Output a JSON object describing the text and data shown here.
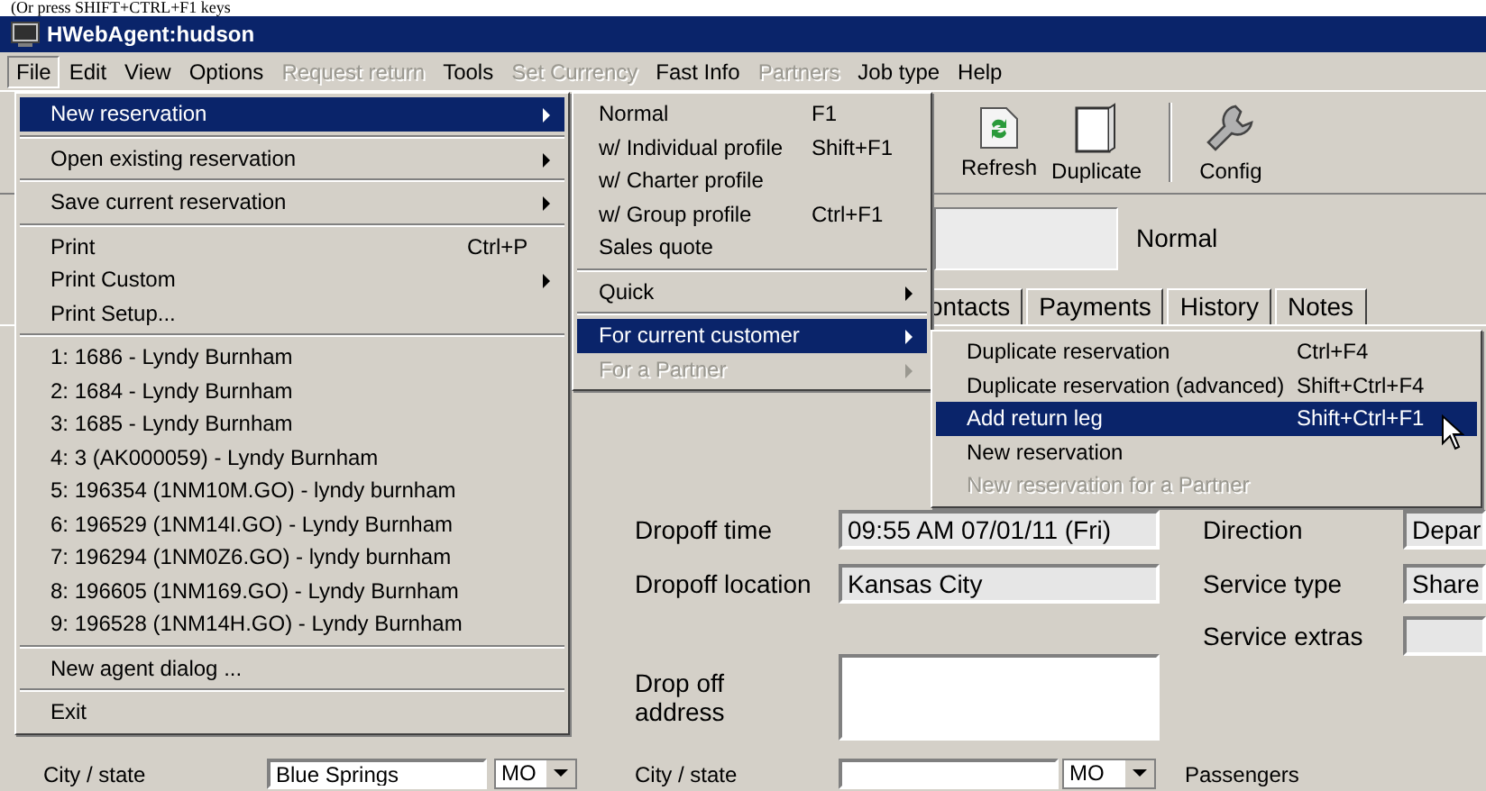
{
  "caption": "(Or press SHIFT+CTRL+F1 keys",
  "window": {
    "title": "HWebAgent:hudson"
  },
  "menubar": [
    {
      "label": "File",
      "selected": true,
      "disabled": false
    },
    {
      "label": "Edit",
      "selected": false,
      "disabled": false
    },
    {
      "label": "View",
      "selected": false,
      "disabled": false
    },
    {
      "label": "Options",
      "selected": false,
      "disabled": false
    },
    {
      "label": "Request return",
      "selected": false,
      "disabled": true
    },
    {
      "label": "Tools",
      "selected": false,
      "disabled": false
    },
    {
      "label": "Set Currency",
      "selected": false,
      "disabled": true
    },
    {
      "label": "Fast Info",
      "selected": false,
      "disabled": false
    },
    {
      "label": "Partners",
      "selected": false,
      "disabled": true
    },
    {
      "label": "Job type",
      "selected": false,
      "disabled": false
    },
    {
      "label": "Help",
      "selected": false,
      "disabled": false
    }
  ],
  "toolbar": [
    {
      "label": "Refresh",
      "kind": "refresh"
    },
    {
      "label": "Duplicate",
      "kind": "page"
    },
    {
      "label": "Config",
      "kind": "wrench"
    }
  ],
  "job_type": "Normal",
  "tabs": [
    {
      "label": "ontacts"
    },
    {
      "label": "Payments"
    },
    {
      "label": "History"
    },
    {
      "label": "Notes"
    }
  ],
  "form": [
    {
      "kind": "pair",
      "label": "Dropoff time",
      "value": "09:55 AM 07/01/11 (Fri)",
      "readonly": true,
      "right_label": "Direction",
      "right_value": "Depar"
    },
    {
      "kind": "pair",
      "label": "Dropoff location",
      "value": "Kansas City",
      "readonly": true,
      "right_label": "Service type",
      "right_value": "Share"
    },
    {
      "kind": "right_only",
      "right_label": "Service extras"
    },
    {
      "kind": "area",
      "label": "Drop off address",
      "readonly": false
    },
    {
      "kind": "city",
      "label": "City / state",
      "readonly": false,
      "combo": "MO",
      "group": "Passengers",
      "left_label": "City / state",
      "left_value": "Blue Springs",
      "left_combo": "MO"
    }
  ],
  "menus": [
    {
      "items": [
        {
          "kind": "item",
          "label": "New reservation",
          "submenu": true,
          "selected": true,
          "disabled": false
        },
        {
          "kind": "separator"
        },
        {
          "kind": "item",
          "label": "Open existing reservation",
          "submenu": true,
          "selected": false,
          "disabled": false
        },
        {
          "kind": "separator"
        },
        {
          "kind": "item",
          "label": "Save current reservation",
          "submenu": true,
          "selected": false,
          "disabled": false
        },
        {
          "kind": "separator"
        },
        {
          "kind": "item",
          "label": "Print",
          "shortcut": "Ctrl+P",
          "submenu": false,
          "selected": false,
          "disabled": false
        },
        {
          "kind": "item",
          "label": "Print Custom",
          "submenu": true,
          "selected": false,
          "disabled": false
        },
        {
          "kind": "item",
          "label": "Print Setup...",
          "submenu": false,
          "selected": false,
          "disabled": false
        },
        {
          "kind": "separator"
        },
        {
          "kind": "item",
          "label": "1: 1686 - Lyndy Burnham",
          "submenu": false,
          "selected": false,
          "disabled": false
        },
        {
          "kind": "item",
          "label": "2: 1684 - Lyndy Burnham",
          "submenu": false,
          "selected": false,
          "disabled": false
        },
        {
          "kind": "item",
          "label": "3: 1685 - Lyndy Burnham",
          "submenu": false,
          "selected": false,
          "disabled": false
        },
        {
          "kind": "item",
          "label": "4: 3 (AK000059) - Lyndy Burnham",
          "submenu": false,
          "selected": false,
          "disabled": false
        },
        {
          "kind": "item",
          "label": "5: 196354 (1NM10M.GO) - lyndy burnham",
          "submenu": false,
          "selected": false,
          "disabled": false
        },
        {
          "kind": "item",
          "label": "6: 196529 (1NM14I.GO) - Lyndy Burnham",
          "submenu": false,
          "selected": false,
          "disabled": false
        },
        {
          "kind": "item",
          "label": "7: 196294 (1NM0Z6.GO) - lyndy burnham",
          "submenu": false,
          "selected": false,
          "disabled": false
        },
        {
          "kind": "item",
          "label": "8: 196605 (1NM169.GO) - Lyndy Burnham",
          "submenu": false,
          "selected": false,
          "disabled": false
        },
        {
          "kind": "item",
          "label": "9: 196528 (1NM14H.GO) - Lyndy Burnham",
          "submenu": false,
          "selected": false,
          "disabled": false
        },
        {
          "kind": "separator"
        },
        {
          "kind": "item",
          "label": "New agent dialog ...",
          "submenu": false,
          "selected": false,
          "disabled": false
        },
        {
          "kind": "separator"
        },
        {
          "kind": "item",
          "label": "Exit",
          "submenu": false,
          "selected": false,
          "disabled": false
        }
      ]
    },
    {
      "items": [
        {
          "kind": "item",
          "label": "Normal",
          "shortcut": "F1",
          "submenu": false,
          "selected": false,
          "disabled": false
        },
        {
          "kind": "item",
          "label": "w/ Individual profile",
          "shortcut": "Shift+F1",
          "submenu": false,
          "selected": false,
          "disabled": false
        },
        {
          "kind": "item",
          "label": "w/ Charter profile",
          "submenu": false,
          "selected": false,
          "disabled": false
        },
        {
          "kind": "item",
          "label": "w/ Group profile",
          "shortcut": "Ctrl+F1",
          "submenu": false,
          "selected": false,
          "disabled": false
        },
        {
          "kind": "item",
          "label": "Sales quote",
          "submenu": false,
          "selected": false,
          "disabled": false
        },
        {
          "kind": "separator"
        },
        {
          "kind": "item",
          "label": "Quick",
          "submenu": true,
          "selected": false,
          "disabled": false
        },
        {
          "kind": "separator"
        },
        {
          "kind": "item",
          "label": "For current customer",
          "submenu": true,
          "selected": true,
          "disabled": false
        },
        {
          "kind": "item",
          "label": "For a Partner",
          "submenu": true,
          "selected": false,
          "disabled": true
        }
      ]
    },
    {
      "items": [
        {
          "kind": "item",
          "label": "Duplicate reservation",
          "shortcut": "Ctrl+F4",
          "submenu": false,
          "selected": false,
          "disabled": false
        },
        {
          "kind": "item",
          "label": "Duplicate reservation (advanced)",
          "shortcut": "Shift+Ctrl+F4",
          "submenu": false,
          "selected": false,
          "disabled": false
        },
        {
          "kind": "item",
          "label": "Add return leg",
          "shortcut": "Shift+Ctrl+F1",
          "submenu": false,
          "selected": true,
          "disabled": false
        },
        {
          "kind": "item",
          "label": "New reservation",
          "submenu": false,
          "selected": false,
          "disabled": false
        },
        {
          "kind": "item",
          "label": "New reservation for a Partner",
          "submenu": false,
          "selected": false,
          "disabled": true
        }
      ]
    }
  ]
}
